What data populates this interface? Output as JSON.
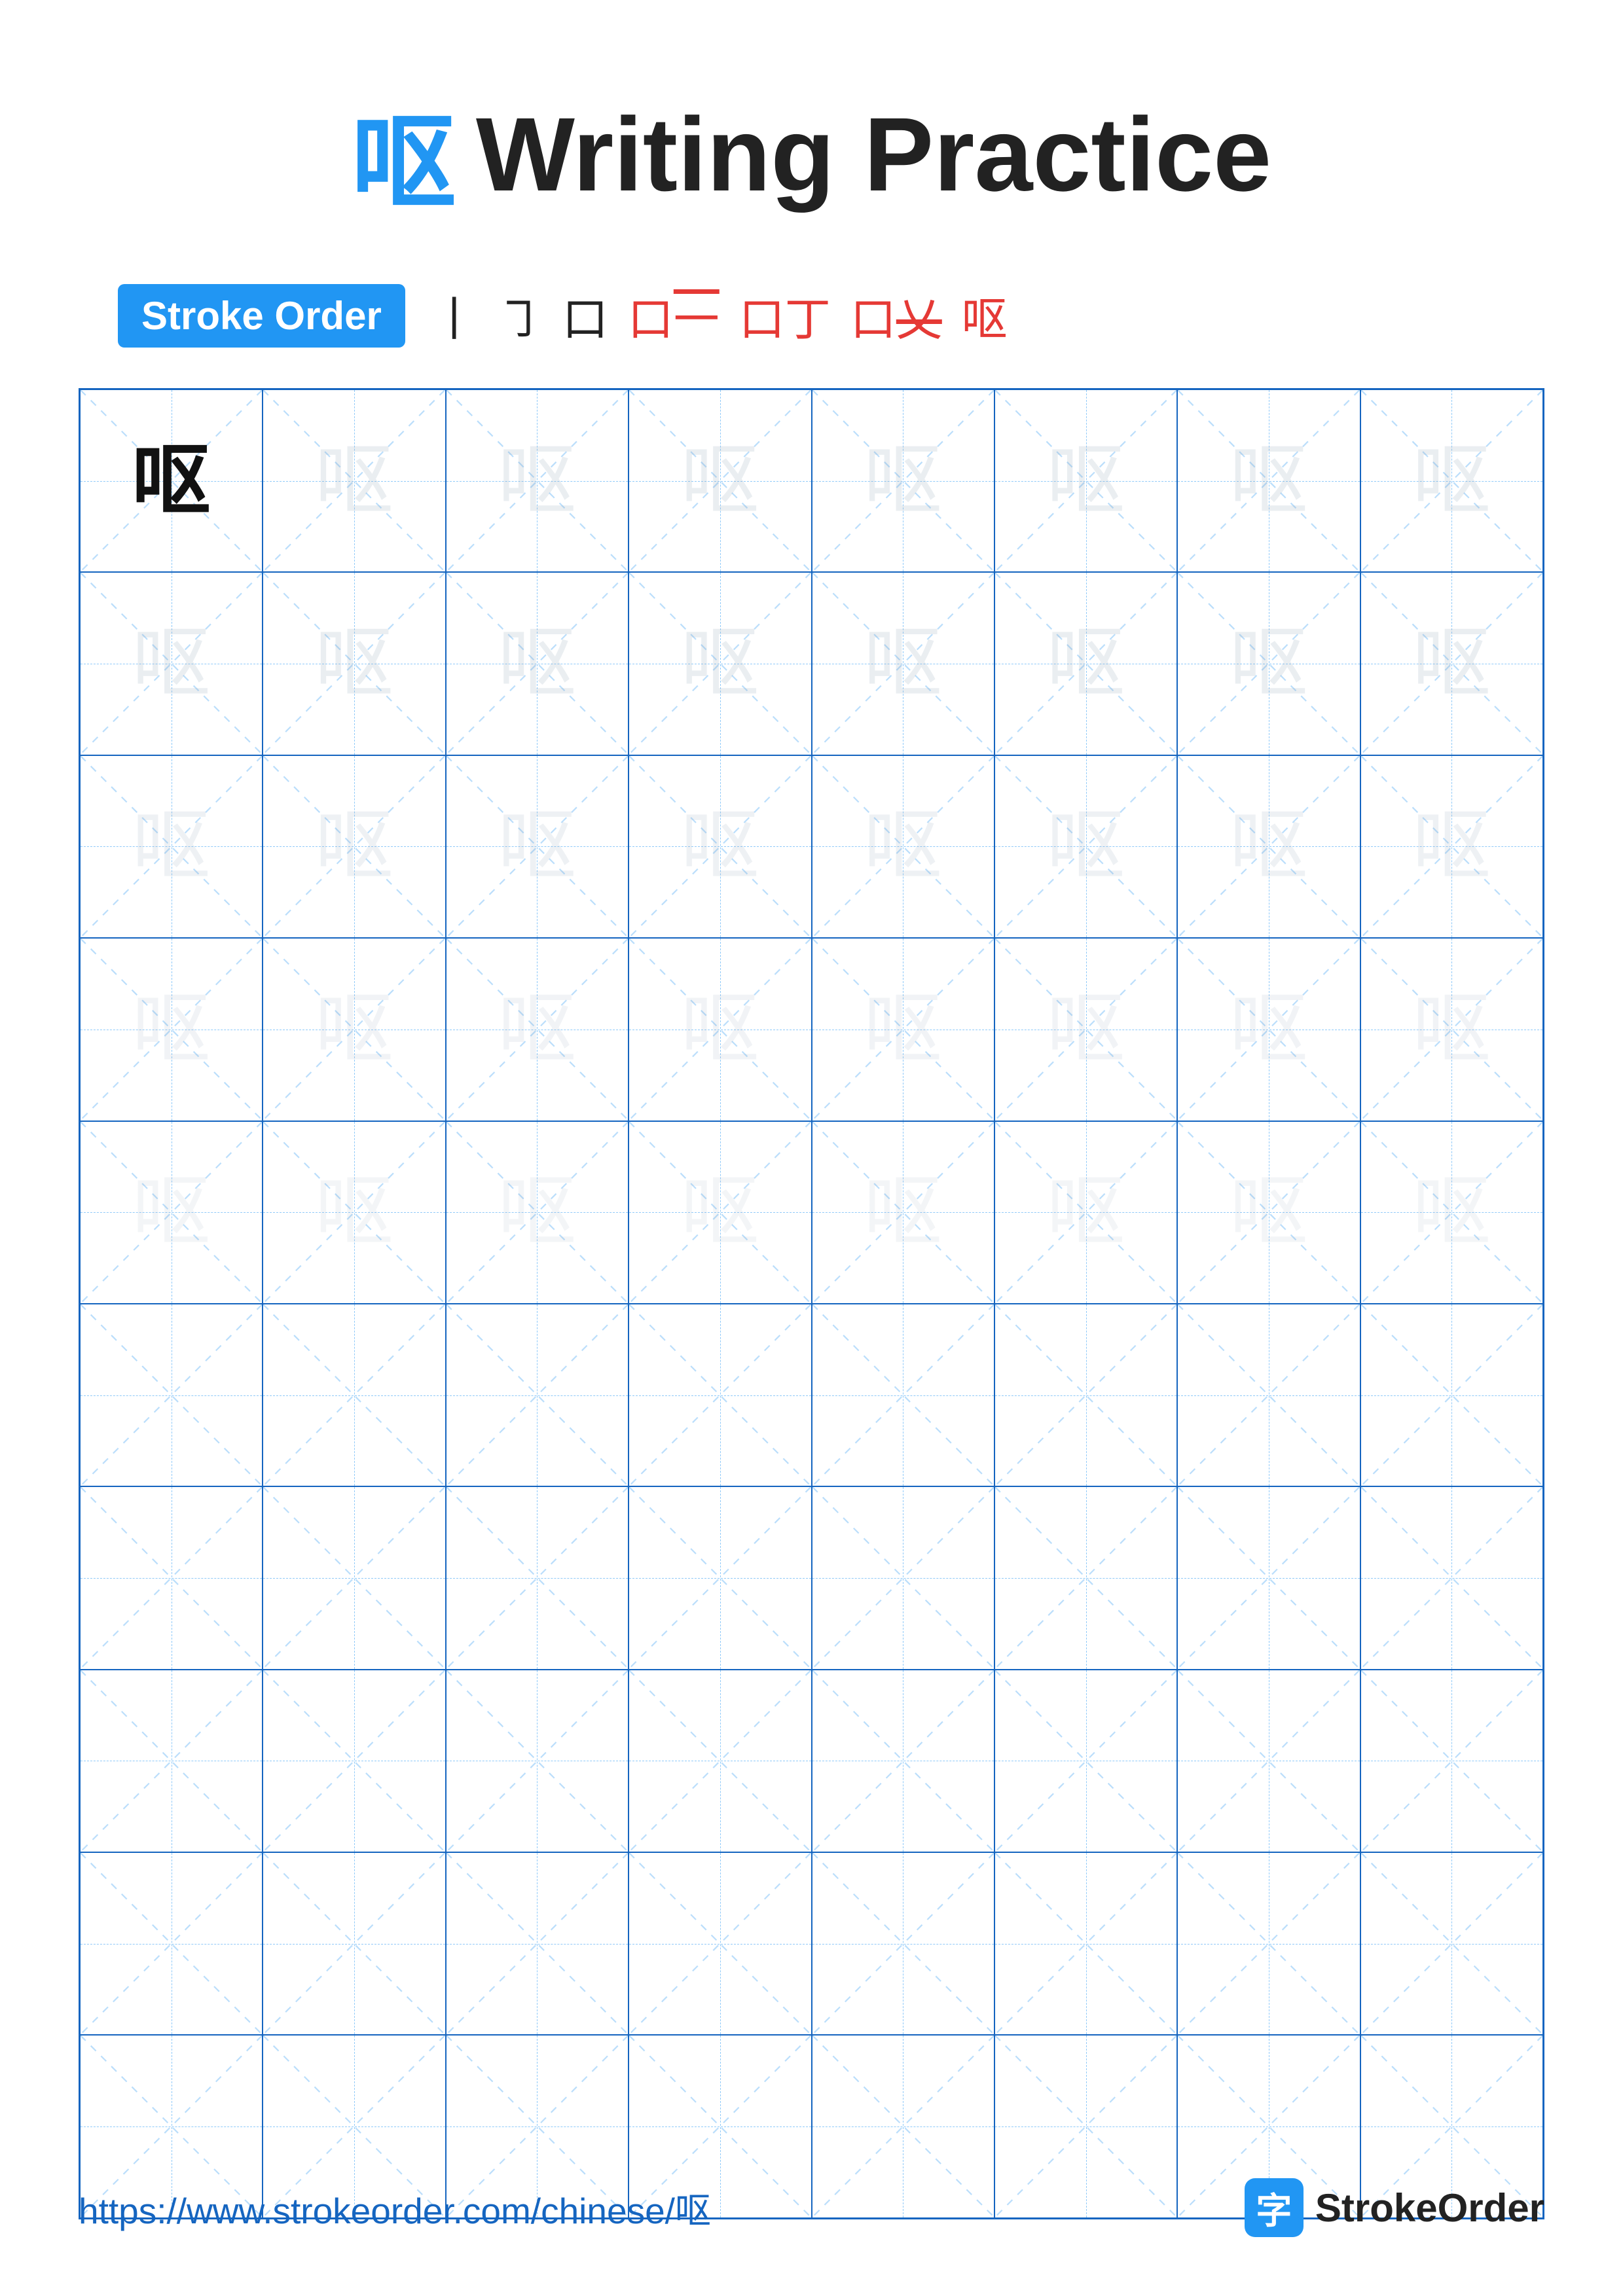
{
  "title": {
    "chinese": "呕",
    "english": "Writing Practice"
  },
  "stroke_order": {
    "badge_label": "Stroke Order",
    "steps": [
      "丨",
      "㇆",
      "口",
      "口一",
      "口丁",
      "口乂",
      "呕"
    ]
  },
  "grid": {
    "rows": 10,
    "cols": 8,
    "char": "呕",
    "filled_rows": 5,
    "empty_rows": 5
  },
  "footer": {
    "url": "https://www.strokeorder.com/chinese/呕",
    "brand_icon": "字",
    "brand_name": "StrokeOrder"
  }
}
